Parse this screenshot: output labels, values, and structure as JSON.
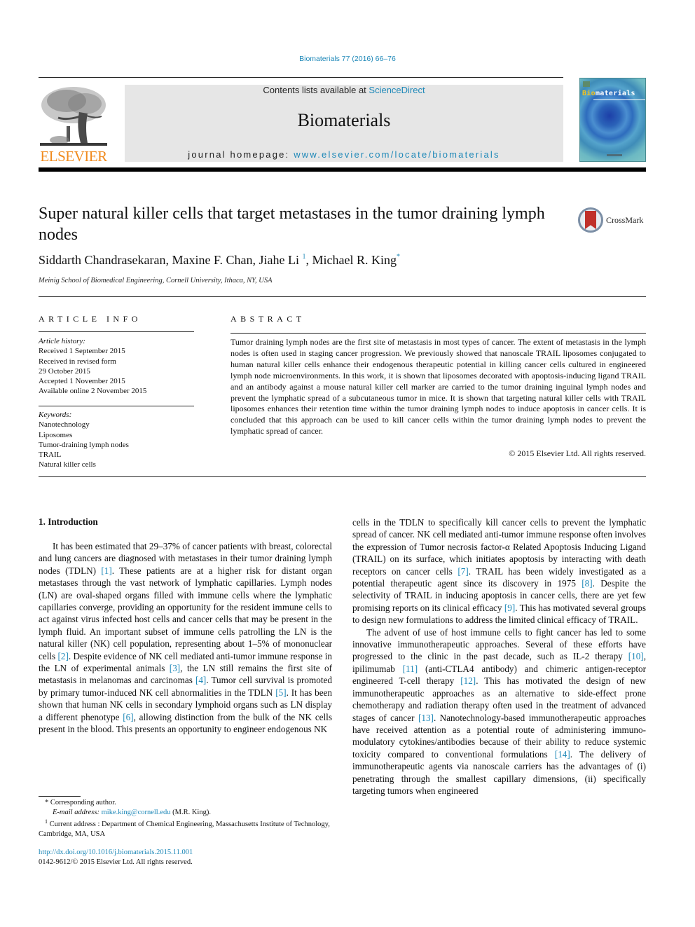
{
  "citation": "Biomaterials 77 (2016) 66–76",
  "header": {
    "publisher_logo_text": "ELSEVIER",
    "contents_prefix": "Contents lists available at ",
    "contents_link": "ScienceDirect",
    "journal_title": "Biomaterials",
    "homepage_prefix": "journal homepage: ",
    "homepage_link": "www.elsevier.com/locate/biomaterials",
    "cover_title_accent": "Bio",
    "cover_title_rest": "materials"
  },
  "crossmark_label": "CrossMark",
  "article": {
    "title": "Super natural killer cells that target metastases in the tumor draining lymph nodes",
    "authors": [
      {
        "name": "Siddarth Chandrasekaran",
        "mark": ""
      },
      {
        "name": "Maxine F. Chan",
        "mark": ""
      },
      {
        "name": "Jiahe Li",
        "mark": "1"
      },
      {
        "name": "Michael R. King",
        "mark": "*"
      }
    ],
    "affiliation": "Meinig School of Biomedical Engineering, Cornell University, Ithaca, NY, USA"
  },
  "article_info": {
    "heading": "ARTICLE INFO",
    "history_label": "Article history:",
    "history": [
      "Received 1 September 2015",
      "Received in revised form",
      "29 October 2015",
      "Accepted 1 November 2015",
      "Available online 2 November 2015"
    ],
    "keywords_label": "Keywords:",
    "keywords": [
      "Nanotechnology",
      "Liposomes",
      "Tumor-draining lymph nodes",
      "TRAIL",
      "Natural killer cells"
    ]
  },
  "abstract": {
    "heading": "ABSTRACT",
    "text": "Tumor draining lymph nodes are the first site of metastasis in most types of cancer. The extent of metastasis in the lymph nodes is often used in staging cancer progression. We previously showed that nanoscale TRAIL liposomes conjugated to human natural killer cells enhance their endogenous thera­peutic potential in killing cancer cells cultured in engineered lymph node microenvironments. In this work, it is shown that liposomes decorated with apoptosis-inducing ligand TRAIL and an antibody against a mouse natural killer cell marker are carried to the tumor draining inguinal lymph nodes and prevent the lymphatic spread of a subcutaneous tumor in mice. It is shown that targeting natural killer cells with TRAIL liposomes enhances their retention time within the tumor draining lymph nodes to induce apoptosis in cancer cells. It is concluded that this approach can be used to kill cancer cells within the tumor draining lymph nodes to prevent the lymphatic spread of cancer.",
    "copyright": "© 2015 Elsevier Ltd. All rights reserved."
  },
  "intro": {
    "heading": "1.  Introduction",
    "left_paragraph": [
      {
        "t": "It has been estimated that 29–37% of cancer patients with breast, colorectal and lung cancers are diagnosed with metastases in their tumor draining lymph nodes (TDLN) "
      },
      {
        "ref": "[1]"
      },
      {
        "t": ". These patients are at a higher risk for distant organ metastases through the vast network of lymphatic capillaries. Lymph nodes (LN) are oval-shaped organs filled with immune cells where the lymphatic cap­illaries converge, providing an opportunity for the resident im­mune cells to act against virus infected host cells and cancer cells that may be present in the lymph fluid. An important subset of immune cells patrolling the LN is the natural killer (NK) cell pop­ulation, representing about 1–5% of mononuclear cells "
      },
      {
        "ref": "[2]"
      },
      {
        "t": ". Despite evidence of NK cell mediated anti-tumor immune response in the LN of experimental animals "
      },
      {
        "ref": "[3]"
      },
      {
        "t": ", the LN still remains the first site of metastasis in melanomas and carcinomas "
      },
      {
        "ref": "[4]"
      },
      {
        "t": ". Tumor cell survival is promoted by primary tumor-induced NK cell abnormalities in the TDLN "
      },
      {
        "ref": "[5]"
      },
      {
        "t": ". It has been shown that human NK cells in secondary lymphoid organs such as LN display a different phenotype "
      },
      {
        "ref": "[6]"
      },
      {
        "t": ", allowing distinction from the bulk of the NK cells present in the blood. This presents an opportunity to engineer endogenous NK"
      }
    ],
    "right_paragraph_1": [
      {
        "t": "cells in the TDLN to specifically kill cancer cells to prevent the lymphatic spread of cancer. NK cell mediated anti-tumor immune response often involves the expression of Tumor necrosis factor-α Related Apoptosis Inducing Ligand (TRAIL) on its surface, which initiates apoptosis by interacting with death receptors on cancer cells "
      },
      {
        "ref": "[7]"
      },
      {
        "t": ". TRAIL has been widely investigated as a potential thera­peutic agent since its discovery in 1975 "
      },
      {
        "ref": "[8]"
      },
      {
        "t": ". Despite the selectivity of TRAIL in inducing apoptosis in cancer cells, there are yet few promising reports on its clinical efficacy "
      },
      {
        "ref": "[9]"
      },
      {
        "t": ". This has motivated several groups to design new formulations to address the limited clinical efficacy of TRAIL."
      }
    ],
    "right_paragraph_2": [
      {
        "t": "The advent of use of host immune cells to fight cancer has led to some innovative immunotherapeutic approaches. Several of these efforts have progressed to the clinic in the past decade, such as IL-2 therapy "
      },
      {
        "ref": "[10]"
      },
      {
        "t": ", ipilimumab "
      },
      {
        "ref": "[11]"
      },
      {
        "t": " (anti-CTLA4 antibody) and chimeric antigen-receptor engineered T-cell therapy "
      },
      {
        "ref": "[12]"
      },
      {
        "t": ". This has motivated the design of new immunotherapeutic approaches as an alternative to side-effect prone chemotherapy and radiation therapy often used in the treatment of advanced stages of cancer "
      },
      {
        "ref": "[13]"
      },
      {
        "t": ". Nanotechnology-based immunotherapeutic approaches have received attention as a potential route of administering immuno­modulatory cytokines/antibodies because of their ability to reduce systemic toxicity compared to conventional formulations "
      },
      {
        "ref": "[14]"
      },
      {
        "t": ". The delivery of immunotherapeutic agents via nanoscale carriers has the advantages of (i) penetrating through the smallest capillary dimensions, (ii) specifically targeting tumors when engineered"
      }
    ]
  },
  "footnotes": {
    "corresponding_mark": "*",
    "corresponding": "Corresponding author.",
    "email_label": "E-mail address: ",
    "email": "mike.king@cornell.edu",
    "email_suffix": " (M.R. King).",
    "current_mark": "1",
    "current_address": "Current address : Department of Chemical Engineering, Massachusetts Institute of Technology, Cambridge, MA, USA",
    "doi": "http://dx.doi.org/10.1016/j.biomaterials.2015.11.001",
    "issn": "0142-9612/© 2015 Elsevier Ltd. All rights reserved."
  },
  "colors": {
    "link": "#1e88b8",
    "elsevier_orange": "#f08a1d",
    "header_gray": "#e6e6e6"
  }
}
